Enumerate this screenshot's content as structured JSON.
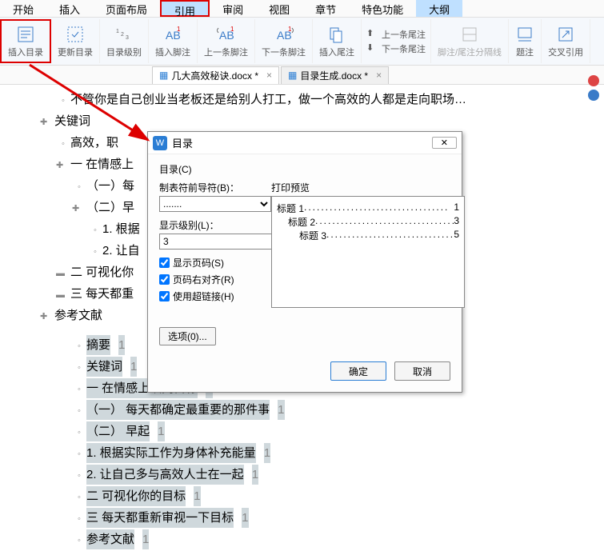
{
  "menu": [
    "开始",
    "插入",
    "页面布局",
    "引用",
    "审阅",
    "视图",
    "章节",
    "特色功能",
    "大纲"
  ],
  "menu_active_ref_idx": 3,
  "menu_active_ol_idx": 8,
  "ribbon": {
    "insertToc": "插入目录",
    "updateToc": "更新目录",
    "tocLevel": "目录级别",
    "insertFootnote": "插入脚注",
    "prevFootnote": "上一条脚注",
    "nextFootnote": "下一条脚注",
    "insertEndnote": "插入尾注",
    "prevEndnote": "上一条尾注",
    "nextEndnote": "下一条尾注",
    "fnEnSep": "脚注/尾注分隔线",
    "caption": "题注",
    "crossRef": "交叉引用"
  },
  "tabs": [
    {
      "name": "几大高效秘诀.docx *",
      "active": true
    },
    {
      "name": "目录生成.docx *",
      "active": false
    }
  ],
  "doc": {
    "l0": "不管你是自己创业当老板还是给别人打工，做一个高效的人都是走向职场…",
    "h1": "关键词",
    "h1a": "高效，职",
    "h2": "一  在情感上",
    "h2a": "（一）每",
    "h2b": "（二）早",
    "h2b1": "1. 根据",
    "h2b2": "2. 让自",
    "h3": "二  可视化你",
    "h4": "三  每天都重",
    "h5": "参考文献",
    "sel": [
      {
        "t": "摘要",
        "p": "1"
      },
      {
        "t": "关键词",
        "p": "1"
      },
      {
        "t": "一  在情感上认同目标",
        "p": "1"
      },
      {
        "t": "（一）  每天都确定最重要的那件事",
        "p": "1"
      },
      {
        "t": "（二）  早起",
        "p": "1"
      },
      {
        "t": "1. 根据实际工作为身体补充能量",
        "p": "1"
      },
      {
        "t": "2. 让自己多与高效人士在一起",
        "p": "1"
      },
      {
        "t": "二  可视化你的目标",
        "p": "1"
      },
      {
        "t": "三  每天都重新审视一下目标",
        "p": "1"
      },
      {
        "t": "参考文献",
        "p": "1"
      }
    ]
  },
  "dialog": {
    "title": "目录",
    "grpLabel": "目录(C)",
    "tabLeaderLabel": "制表符前导符(B)：",
    "tabLeaderValue": ".......",
    "showLevelLabel": "显示级别(L)：",
    "showLevelValue": "3",
    "chkPage": "显示页码(S)",
    "chkAlign": "页码右对齐(R)",
    "chkHyper": "使用超链接(H)",
    "previewLabel": "打印预览",
    "preview": [
      {
        "name": "标题 1",
        "page": "1",
        "indent": 0
      },
      {
        "name": "标题 2",
        "page": "3",
        "indent": 1
      },
      {
        "name": "标题 3",
        "page": "5",
        "indent": 2
      }
    ],
    "optionsBtn": "选项(0)...",
    "ok": "确定",
    "cancel": "取消"
  }
}
